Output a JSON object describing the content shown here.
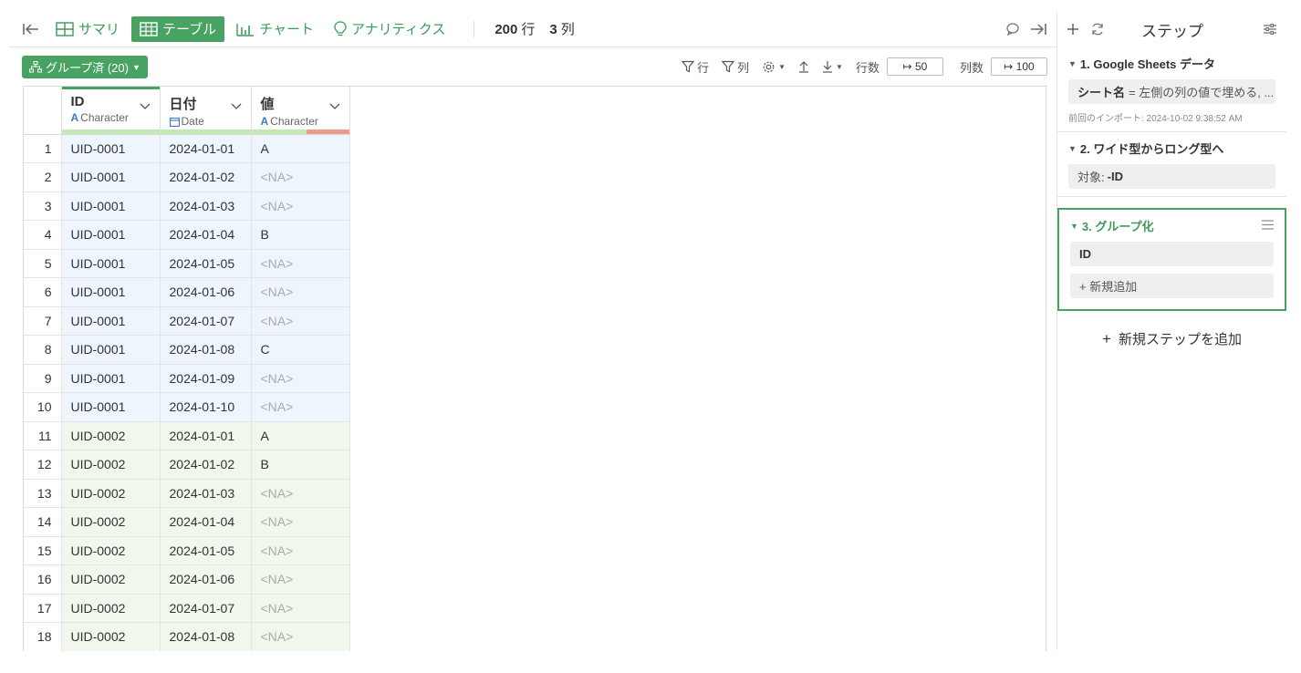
{
  "toolbar": {
    "tabs": [
      {
        "label": "サマリ",
        "icon": "summary-grid-icon",
        "active": false
      },
      {
        "label": "テーブル",
        "icon": "table-icon",
        "active": true
      },
      {
        "label": "チャート",
        "icon": "bar-chart-icon",
        "active": false
      },
      {
        "label": "アナリティクス",
        "icon": "lightbulb-icon",
        "active": false
      }
    ],
    "rows_value": "200",
    "rows_label": "行",
    "cols_value": "3",
    "cols_label": "列"
  },
  "grid": {
    "group_button": "グループ済 (20)",
    "filter_row": "行",
    "filter_col": "列",
    "row_limit_label": "行数",
    "row_limit_value": "↦ 50",
    "col_limit_label": "列数",
    "col_limit_value": "↦ 100"
  },
  "columns": [
    {
      "name": "ID",
      "type": "Character"
    },
    {
      "name": "日付",
      "type": "Date"
    },
    {
      "name": "値",
      "type": "Character"
    }
  ],
  "rows": [
    {
      "n": "1",
      "id": "UID-0001",
      "date": "2024-01-01",
      "val": "A",
      "group": 1
    },
    {
      "n": "2",
      "id": "UID-0001",
      "date": "2024-01-02",
      "val": "<NA>",
      "group": 1
    },
    {
      "n": "3",
      "id": "UID-0001",
      "date": "2024-01-03",
      "val": "<NA>",
      "group": 1
    },
    {
      "n": "4",
      "id": "UID-0001",
      "date": "2024-01-04",
      "val": "B",
      "group": 1
    },
    {
      "n": "5",
      "id": "UID-0001",
      "date": "2024-01-05",
      "val": "<NA>",
      "group": 1
    },
    {
      "n": "6",
      "id": "UID-0001",
      "date": "2024-01-06",
      "val": "<NA>",
      "group": 1
    },
    {
      "n": "7",
      "id": "UID-0001",
      "date": "2024-01-07",
      "val": "<NA>",
      "group": 1
    },
    {
      "n": "8",
      "id": "UID-0001",
      "date": "2024-01-08",
      "val": "C",
      "group": 1
    },
    {
      "n": "9",
      "id": "UID-0001",
      "date": "2024-01-09",
      "val": "<NA>",
      "group": 1
    },
    {
      "n": "10",
      "id": "UID-0001",
      "date": "2024-01-10",
      "val": "<NA>",
      "group": 1
    },
    {
      "n": "11",
      "id": "UID-0002",
      "date": "2024-01-01",
      "val": "A",
      "group": 2
    },
    {
      "n": "12",
      "id": "UID-0002",
      "date": "2024-01-02",
      "val": "B",
      "group": 2
    },
    {
      "n": "13",
      "id": "UID-0002",
      "date": "2024-01-03",
      "val": "<NA>",
      "group": 2
    },
    {
      "n": "14",
      "id": "UID-0002",
      "date": "2024-01-04",
      "val": "<NA>",
      "group": 2
    },
    {
      "n": "15",
      "id": "UID-0002",
      "date": "2024-01-05",
      "val": "<NA>",
      "group": 2
    },
    {
      "n": "16",
      "id": "UID-0002",
      "date": "2024-01-06",
      "val": "<NA>",
      "group": 2
    },
    {
      "n": "17",
      "id": "UID-0002",
      "date": "2024-01-07",
      "val": "<NA>",
      "group": 2
    },
    {
      "n": "18",
      "id": "UID-0002",
      "date": "2024-01-08",
      "val": "<NA>",
      "group": 2
    }
  ],
  "steps_panel": {
    "title": "ステップ",
    "steps": [
      {
        "title": "1. Google Sheets データ",
        "chip_key": "シート名",
        "chip_value": "= 左側の列の値で埋める, ...",
        "note": "前回のインポート: 2024-10-02 9:38:52 AM"
      },
      {
        "title": "2. ワイド型からロング型へ",
        "chip_key": "対象:",
        "chip_value": "-ID"
      },
      {
        "title": "3. グループ化",
        "chip_key": "ID",
        "add_label": "+ 新規追加"
      }
    ],
    "add_step_label": "新規ステップを追加"
  },
  "colors": {
    "accent": "#48a363",
    "group1_bg": "#eef5fd",
    "group2_bg": "#f1f7ec",
    "na_text": "#aaaaaa",
    "quality_valid": "#c5e8b7",
    "quality_missing": "#ec9c8d"
  }
}
